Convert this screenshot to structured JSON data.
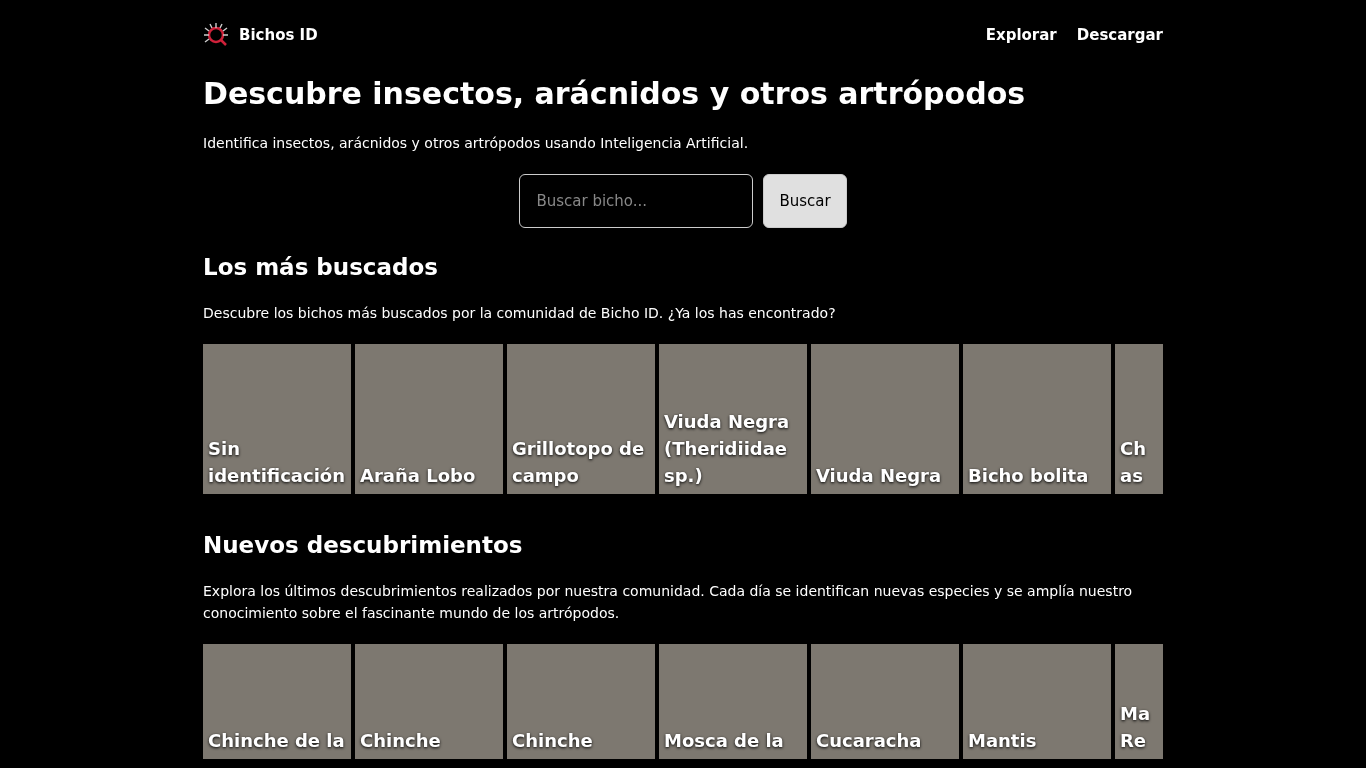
{
  "header": {
    "brand": "Bichos ID",
    "nav": [
      "Explorar",
      "Descargar"
    ]
  },
  "hero": {
    "title": "Descubre insectos, arácnidos y otros artrópodos",
    "subtitle": "Identifica insectos, arácnidos y otros artrópodos usando Inteligencia Artificial.",
    "search": {
      "placeholder": "Buscar bicho..."
    },
    "button": "Buscar"
  },
  "sections": [
    {
      "title": "Los más buscados",
      "description": "Descubre los bichos más buscados por la comunidad de Bicho ID. ¿Ya los has encontrado?",
      "cards": [
        {
          "name": "Sin identificación"
        },
        {
          "name": "Araña Lobo"
        },
        {
          "name": "Grillotopo de campo"
        },
        {
          "name": "Viuda Negra (Theridiidae sp.)"
        },
        {
          "name": "Viuda Negra"
        },
        {
          "name": "Bicho bolita"
        },
        {
          "name": "Ch as"
        }
      ]
    },
    {
      "title": "Nuevos descubrimientos",
      "description": "Explora los últimos descubrimientos realizados por nuestra comunidad. Cada día se identifican nuevas especies y se amplía nuestro conocimiento sobre el fascinante mundo de los artrópodos.",
      "cards": [
        {
          "name": "Chinche de la"
        },
        {
          "name": "Chinche"
        },
        {
          "name": "Chinche"
        },
        {
          "name": "Mosca de la"
        },
        {
          "name": "Cucaracha"
        },
        {
          "name": "Mantis"
        },
        {
          "name": "Ma Re"
        }
      ]
    }
  ]
}
